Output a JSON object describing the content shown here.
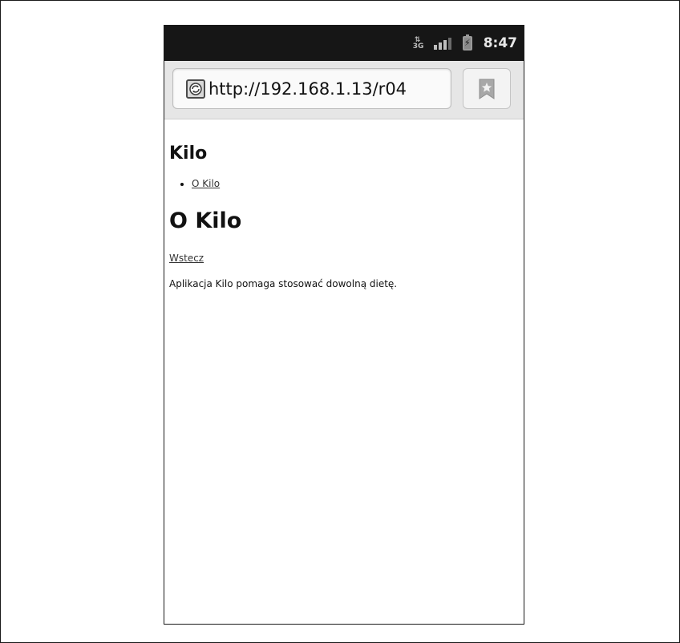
{
  "statusbar": {
    "network_label": "3G",
    "clock": "8:47",
    "icons": [
      "data-transfer-icon",
      "signal-icon",
      "battery-charging-icon"
    ]
  },
  "browser": {
    "url": "http://192.168.1.13/r04",
    "site_icon": "globe-icon",
    "bookmark_icon": "bookmark-icon"
  },
  "page": {
    "app_title": "Kilo",
    "menu_items": [
      {
        "label": "O Kilo"
      }
    ],
    "section_title": "O Kilo",
    "back_link": "Wstecz",
    "description": "Aplikacja Kilo pomaga stosować dowolną dietę."
  }
}
